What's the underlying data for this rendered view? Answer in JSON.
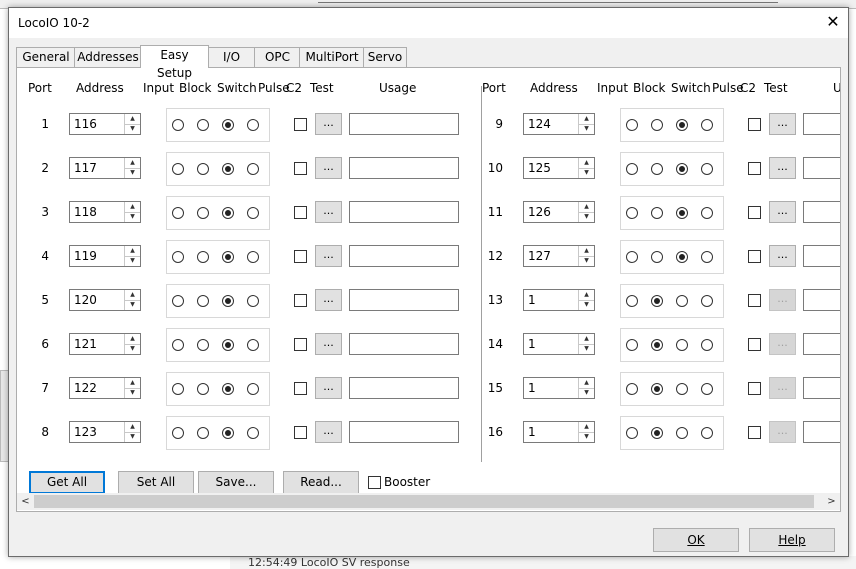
{
  "window": {
    "title": "LocoIO  10-2"
  },
  "tabs": [
    {
      "label": "General",
      "active": false
    },
    {
      "label": "Addresses",
      "active": false
    },
    {
      "label": "Easy Setup",
      "active": true
    },
    {
      "label": "I/O",
      "active": false
    },
    {
      "label": "OPC",
      "active": false
    },
    {
      "label": "MultiPort",
      "active": false
    },
    {
      "label": "Servo",
      "active": false
    }
  ],
  "headers": {
    "port": "Port",
    "address": "Address",
    "input": "Input",
    "block": "Block",
    "switch": "Switch",
    "pulse": "Pulse",
    "c2": "C2",
    "test": "Test",
    "usage": "Usage"
  },
  "left_ports": [
    {
      "port": "1",
      "address": "116",
      "mode": 2,
      "c2": false,
      "test": "...",
      "test_enabled": true,
      "usage": ""
    },
    {
      "port": "2",
      "address": "117",
      "mode": 2,
      "c2": false,
      "test": "...",
      "test_enabled": true,
      "usage": ""
    },
    {
      "port": "3",
      "address": "118",
      "mode": 2,
      "c2": false,
      "test": "...",
      "test_enabled": true,
      "usage": ""
    },
    {
      "port": "4",
      "address": "119",
      "mode": 2,
      "c2": false,
      "test": "...",
      "test_enabled": true,
      "usage": ""
    },
    {
      "port": "5",
      "address": "120",
      "mode": 2,
      "c2": false,
      "test": "...",
      "test_enabled": true,
      "usage": ""
    },
    {
      "port": "6",
      "address": "121",
      "mode": 2,
      "c2": false,
      "test": "...",
      "test_enabled": true,
      "usage": ""
    },
    {
      "port": "7",
      "address": "122",
      "mode": 2,
      "c2": false,
      "test": "...",
      "test_enabled": true,
      "usage": ""
    },
    {
      "port": "8",
      "address": "123",
      "mode": 2,
      "c2": false,
      "test": "...",
      "test_enabled": true,
      "usage": ""
    }
  ],
  "right_ports": [
    {
      "port": "9",
      "address": "124",
      "mode": 2,
      "c2": false,
      "test": "...",
      "test_enabled": true,
      "usage": ""
    },
    {
      "port": "10",
      "address": "125",
      "mode": 2,
      "c2": false,
      "test": "...",
      "test_enabled": true,
      "usage": ""
    },
    {
      "port": "11",
      "address": "126",
      "mode": 2,
      "c2": false,
      "test": "...",
      "test_enabled": true,
      "usage": ""
    },
    {
      "port": "12",
      "address": "127",
      "mode": 2,
      "c2": false,
      "test": "...",
      "test_enabled": true,
      "usage": ""
    },
    {
      "port": "13",
      "address": "1",
      "mode": 1,
      "c2": false,
      "test": "...",
      "test_enabled": false,
      "usage": ""
    },
    {
      "port": "14",
      "address": "1",
      "mode": 1,
      "c2": false,
      "test": "...",
      "test_enabled": false,
      "usage": ""
    },
    {
      "port": "15",
      "address": "1",
      "mode": 1,
      "c2": false,
      "test": "...",
      "test_enabled": false,
      "usage": ""
    },
    {
      "port": "16",
      "address": "1",
      "mode": 1,
      "c2": false,
      "test": "...",
      "test_enabled": false,
      "usage": ""
    }
  ],
  "actions": {
    "get_all": "Get All",
    "set_all": "Set All",
    "save": "Save...",
    "read": "Read...",
    "booster": "Booster",
    "booster_checked": false
  },
  "dialog": {
    "ok": "OK",
    "help": "Help"
  },
  "background": {
    "status_text": "12:54:49 LocoIO SV response"
  }
}
